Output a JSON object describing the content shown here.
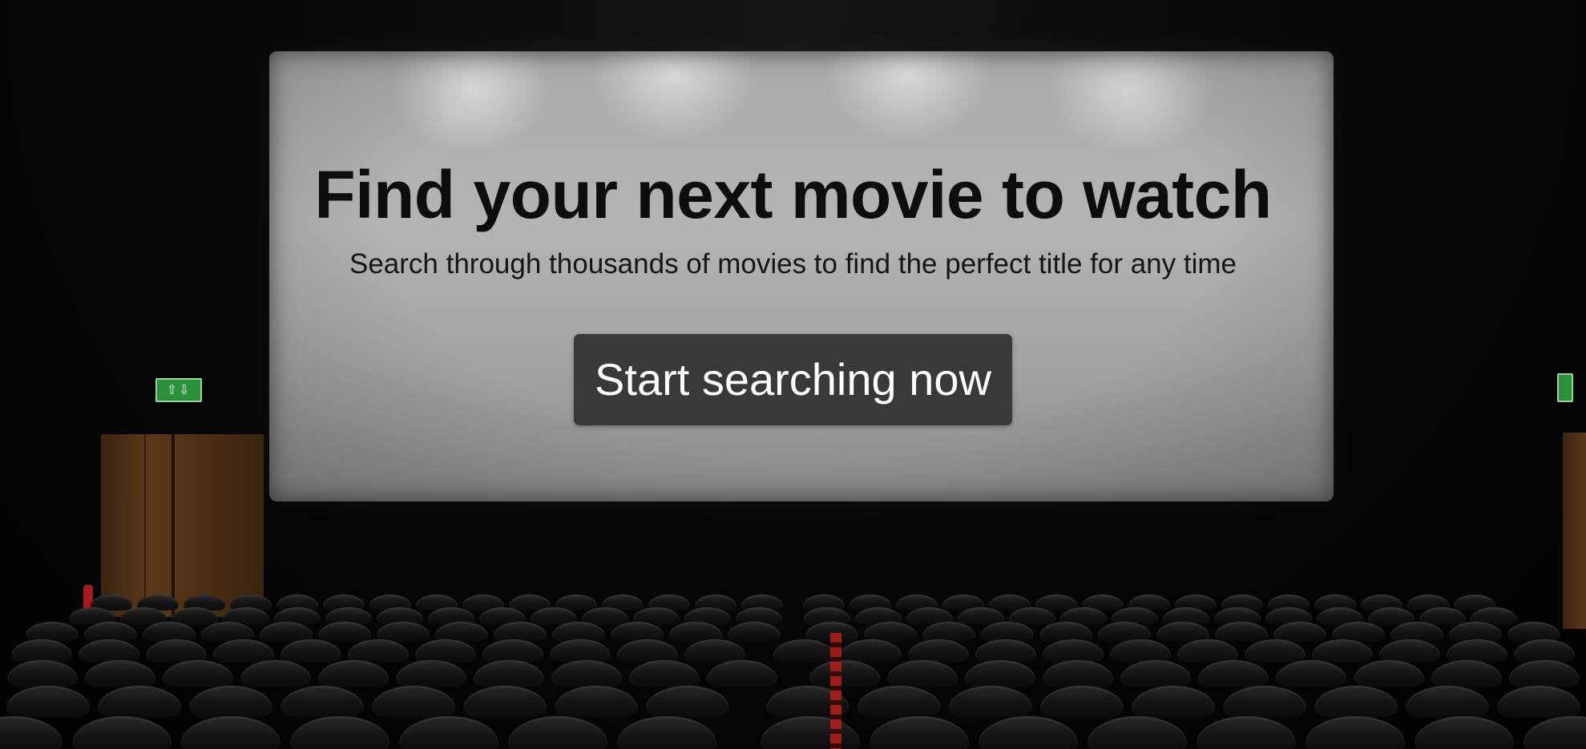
{
  "hero": {
    "title": "Find your next movie to watch",
    "subtitle": "Search through thousands of movies to find the perfect title for any time",
    "cta_label": "Start searching now"
  },
  "background": {
    "scene": "cinema-auditorium-icon",
    "exit_sign_glyph": "⇧⇩"
  },
  "colors": {
    "screen": "#b0b0b0",
    "title_text": "#0d0d0d",
    "button_bg": "#393939",
    "button_text": "#ffffff",
    "room": "#050505",
    "seat": "#1a1a1a",
    "aisle_light": "#b3201c"
  }
}
